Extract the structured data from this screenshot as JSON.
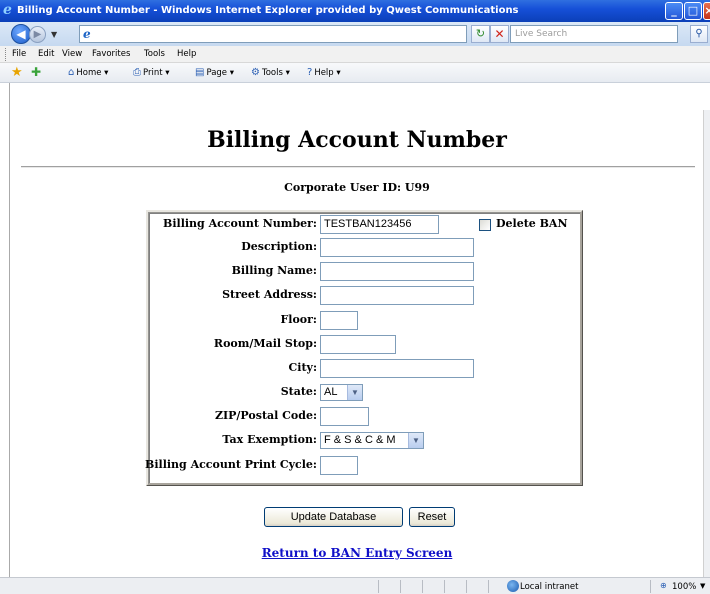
{
  "window": {
    "title": "Billing Account Number - Windows Internet Explorer provided by Qwest Communications"
  },
  "address_bar": {
    "url": "",
    "search_placeholder": "Live Search"
  },
  "menu": {
    "items": [
      "File",
      "Edit",
      "View",
      "Favorites",
      "Tools",
      "Help"
    ]
  },
  "command_bar": {
    "home": "Home",
    "print": "Print",
    "page": "Page",
    "tools": "Tools",
    "help": "Help"
  },
  "page": {
    "title": "Billing Account Number",
    "corporate_user_id": "Corporate User ID: U99"
  },
  "form": {
    "ban_label": "Billing Account Number:",
    "ban_value": "TESTBAN123456",
    "delete_ban_label": "Delete BAN",
    "delete_ban_checked": false,
    "description_label": "Description:",
    "description_value": "",
    "billing_name_label": "Billing Name:",
    "billing_name_value": "",
    "street_address_label": "Street Address:",
    "street_address_value": "",
    "floor_label": "Floor:",
    "floor_value": "",
    "room_label": "Room/Mail Stop:",
    "room_value": "",
    "city_label": "City:",
    "city_value": "",
    "state_label": "State:",
    "state_value": "AL",
    "zip_label": "ZIP/Postal Code:",
    "zip_value": "",
    "tax_label": "Tax Exemption:",
    "tax_value": "F & S & C & M",
    "print_cycle_label": "Billing Account Print Cycle:",
    "print_cycle_value": ""
  },
  "buttons": {
    "update": "Update Database",
    "reset": "Reset"
  },
  "links": {
    "return": "Return to BAN Entry Screen"
  },
  "status_bar": {
    "zone": "Local intranet",
    "zoom": "100%"
  }
}
